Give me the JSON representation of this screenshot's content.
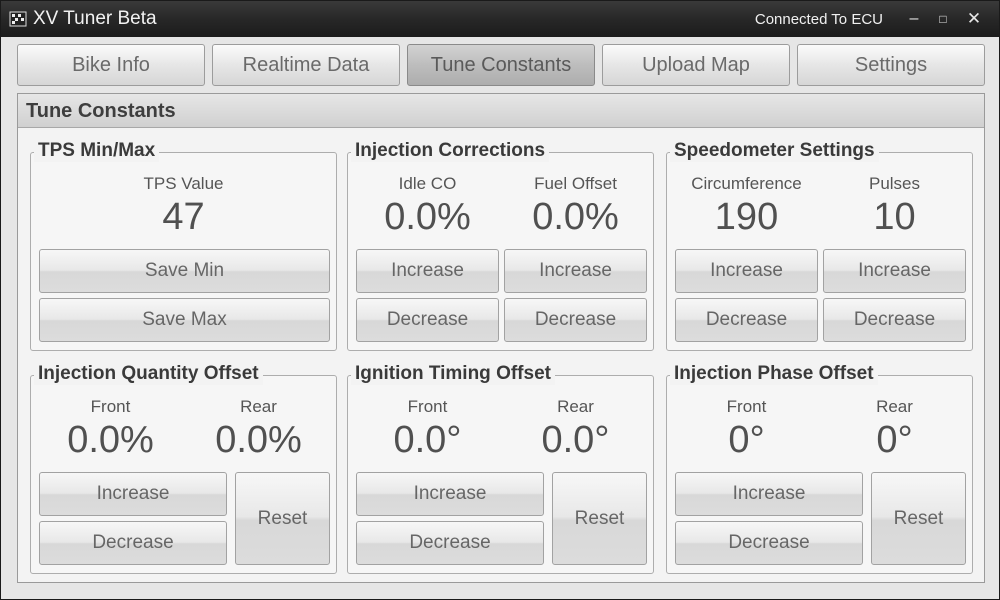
{
  "window": {
    "title": "XV Tuner Beta",
    "status": "Connected To ECU",
    "controls": {
      "minimize": "–",
      "maximize": "□",
      "close": "✕"
    }
  },
  "tabs": [
    {
      "label": "Bike Info"
    },
    {
      "label": "Realtime Data"
    },
    {
      "label": "Tune Constants",
      "active": true
    },
    {
      "label": "Upload Map"
    },
    {
      "label": "Settings"
    }
  ],
  "section": {
    "title": "Tune Constants"
  },
  "groups": {
    "tps": {
      "title": "TPS Min/Max",
      "label": "TPS Value",
      "value": "47",
      "save_min": "Save Min",
      "save_max": "Save Max"
    },
    "injection_corrections": {
      "title": "Injection Corrections",
      "col1": {
        "label": "Idle CO",
        "value": "0.0%",
        "increase": "Increase",
        "decrease": "Decrease"
      },
      "col2": {
        "label": "Fuel Offset",
        "value": "0.0%",
        "increase": "Increase",
        "decrease": "Decrease"
      }
    },
    "speedometer": {
      "title": "Speedometer Settings",
      "col1": {
        "label": "Circumference",
        "value": "190",
        "increase": "Increase",
        "decrease": "Decrease"
      },
      "col2": {
        "label": "Pulses",
        "value": "10",
        "increase": "Increase",
        "decrease": "Decrease"
      }
    },
    "inj_quantity": {
      "title": "Injection Quantity Offset",
      "front_label": "Front",
      "front_value": "0.0%",
      "rear_label": "Rear",
      "rear_value": "0.0%",
      "increase": "Increase",
      "decrease": "Decrease",
      "reset": "Reset"
    },
    "ign_timing": {
      "title": "Ignition Timing Offset",
      "front_label": "Front",
      "front_value": "0.0°",
      "rear_label": "Rear",
      "rear_value": "0.0°",
      "increase": "Increase",
      "decrease": "Decrease",
      "reset": "Reset"
    },
    "inj_phase": {
      "title": "Injection Phase Offset",
      "front_label": "Front",
      "front_value": "0°",
      "rear_label": "Rear",
      "rear_value": "0°",
      "increase": "Increase",
      "decrease": "Decrease",
      "reset": "Reset"
    }
  }
}
